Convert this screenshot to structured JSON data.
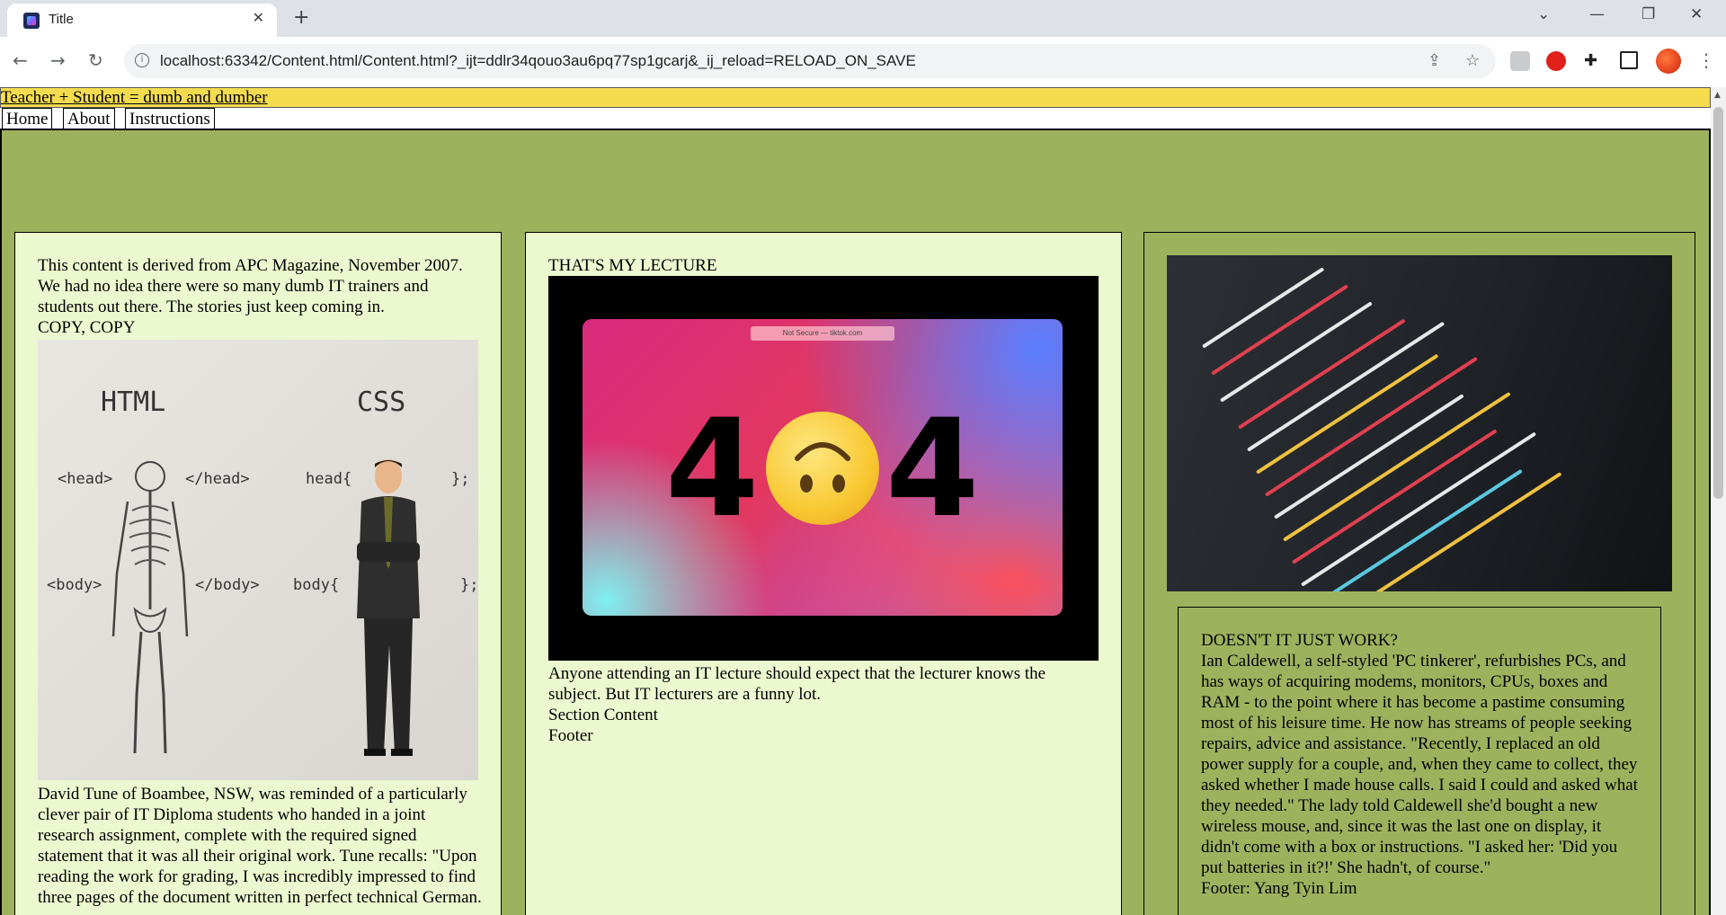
{
  "browser": {
    "tab_title": "Title",
    "tab_close": "✕",
    "new_tab": "+",
    "url": "localhost:63342/Content.html/Content.html?_ijt=ddlr34qouo3au6pq77sp1gcarj&_ij_reload=RELOAD_ON_SAVE",
    "icons": [
      "back-icon",
      "forward-icon",
      "reload-icon",
      "info-icon",
      "share-icon",
      "star-icon",
      "extensions-icon",
      "side-panel-icon",
      "profile-icon"
    ]
  },
  "header": {
    "link_text": "Teacher",
    "rest_text": " + Student = dumb and dumber"
  },
  "nav": {
    "items": [
      "Home",
      "About",
      "Instructions"
    ]
  },
  "col1": {
    "intro": "This content is derived from APC Magazine, November 2007. We had no idea there were so many dumb IT trainers and students out there. The stories just keep coming in.",
    "heading": "COPY, COPY",
    "image_labels": {
      "html": "HTML",
      "css": "CSS",
      "head_open": "<head>",
      "head_close": "</head>",
      "body_open": "<body>",
      "body_close": "</body>",
      "css_head": "head{",
      "css_head_end": "};",
      "css_body": "body{",
      "css_body_end": "};"
    },
    "story": "David Tune of Boambee, NSW, was reminded of a particularly clever pair of IT Diploma students who handed in a joint research assignment, complete with the required signed statement that it was all their original work. Tune recalls: \"Upon reading the work for grading, I was incredibly impressed to find three pages of the document written in perfect technical German."
  },
  "col2": {
    "heading": "THAT'S MY LECTURE",
    "video": {
      "pill_text": "Not Secure — tiktok.com",
      "digit": "4"
    },
    "text": "Anyone attending an IT lecture should expect that the lecturer knows the subject. But IT lecturers are a funny lot.",
    "section_content": "Section Content",
    "footer": "Footer"
  },
  "col3": {
    "heading": "DOESN'T IT JUST WORK?",
    "story": "Ian Caldewell, a self-styled 'PC tinkerer', refurbishes PCs, and has ways of acquiring modems, monitors, CPUs, boxes and RAM - to the point where it has become a pastime consuming most of his leisure time. He now has streams of people seeking repairs, advice and assistance. \"Recently, I replaced an old power supply for a couple, and, when they came to collect, they asked whether I made house calls. I said I could and asked what they needed.\" The lady told Caldewell she'd bought a new wireless mouse, and, since it was the last one on display, it didn't come with a box or instructions. \"I asked her: 'Did you put batteries in it?!' She hadn't, of course.\"",
    "footer": "Footer: Yang Tyin Lim"
  },
  "colors": {
    "header_bg": "#f5dc4f",
    "main_bg": "#9eb25e",
    "column_bg": "#ecf8cf"
  }
}
